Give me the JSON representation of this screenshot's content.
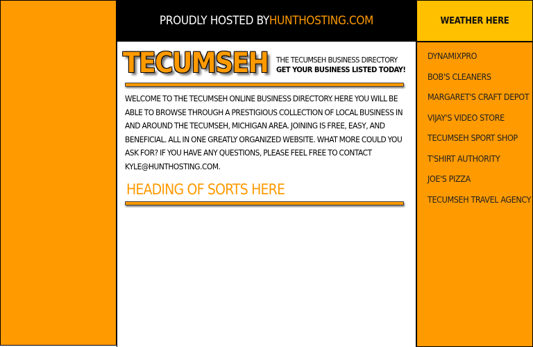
{
  "header": {
    "hosted_prefix": "PROUDLY HOSTED BY ",
    "hosted_link": "HUNTHOSTING.COM",
    "weather": "WEATHER HERE"
  },
  "brand": {
    "logo": "TECUMSEH",
    "tagline_line1": "THE TECUMSEH BUSINESS DIRECTORY",
    "tagline_line2": "GET YOUR BUSINESS LISTED TODAY!"
  },
  "main": {
    "intro": "WELCOME TO THE TECUMSEH ONLINE BUSINESS DIRECTORY.  HERE YOU WILL BE ABLE TO BROWSE THROUGH A PRESTIGIOUS COLLECTION OF LOCAL BUSINESS IN AND AROUND THE TECUMSEH, MICHIGAN AREA.  JOINING IS FREE, EASY, AND BENEFICIAL.  ALL IN ONE GREATLY ORGANIZED WEBSITE.  WHAT MORE COULD YOU ASK FOR?  IF YOU HAVE ANY QUESTIONS, PLEASE FEEL FREE TO CONTACT KYLE@HUNTHOSTING.COM.",
    "heading": "HEADING OF SORTS HERE"
  },
  "sidebar": {
    "businesses": [
      "DYNAMIXPRO",
      "BOB'S CLEANERS",
      "MARGARET'S CRAFT DEPOT",
      "VIJAY'S VIDEO STORE",
      "TECUMSEH SPORT SHOP",
      "T'SHIRT AUTHORITY",
      "JOE'S PIZZA",
      "TECUMSEH TRAVEL AGENCY"
    ]
  },
  "colors": {
    "accent": "#ff9a00",
    "weather_bg": "#ffc000",
    "header_bg": "#000000"
  }
}
